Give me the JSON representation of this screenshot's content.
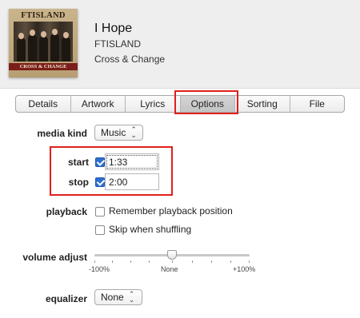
{
  "song": {
    "title": "I Hope",
    "artist": "FTISLAND",
    "album": "Cross & Change",
    "artwork": {
      "band_text": "FTISLAND",
      "subtitle_text": "CROSS & CHANGE"
    }
  },
  "tabs": [
    {
      "label": "Details",
      "active": false
    },
    {
      "label": "Artwork",
      "active": false
    },
    {
      "label": "Lyrics",
      "active": false
    },
    {
      "label": "Options",
      "active": true
    },
    {
      "label": "Sorting",
      "active": false
    },
    {
      "label": "File",
      "active": false
    }
  ],
  "options": {
    "media_kind": {
      "label": "media kind",
      "value": "Music"
    },
    "start": {
      "label": "start",
      "checked": true,
      "value": "1:33"
    },
    "stop": {
      "label": "stop",
      "checked": true,
      "value": "2:00"
    },
    "playback": {
      "label": "playback",
      "remember_position": {
        "label": "Remember playback position",
        "checked": false
      },
      "skip_shuffling": {
        "label": "Skip when shuffling",
        "checked": false
      }
    },
    "volume_adjust": {
      "label": "volume adjust",
      "value_percent": 0,
      "min_label": "-100%",
      "mid_label": "None",
      "max_label": "+100%"
    },
    "equalizer": {
      "label": "equalizer",
      "value": "None"
    }
  },
  "highlight_color": "#e0201a"
}
